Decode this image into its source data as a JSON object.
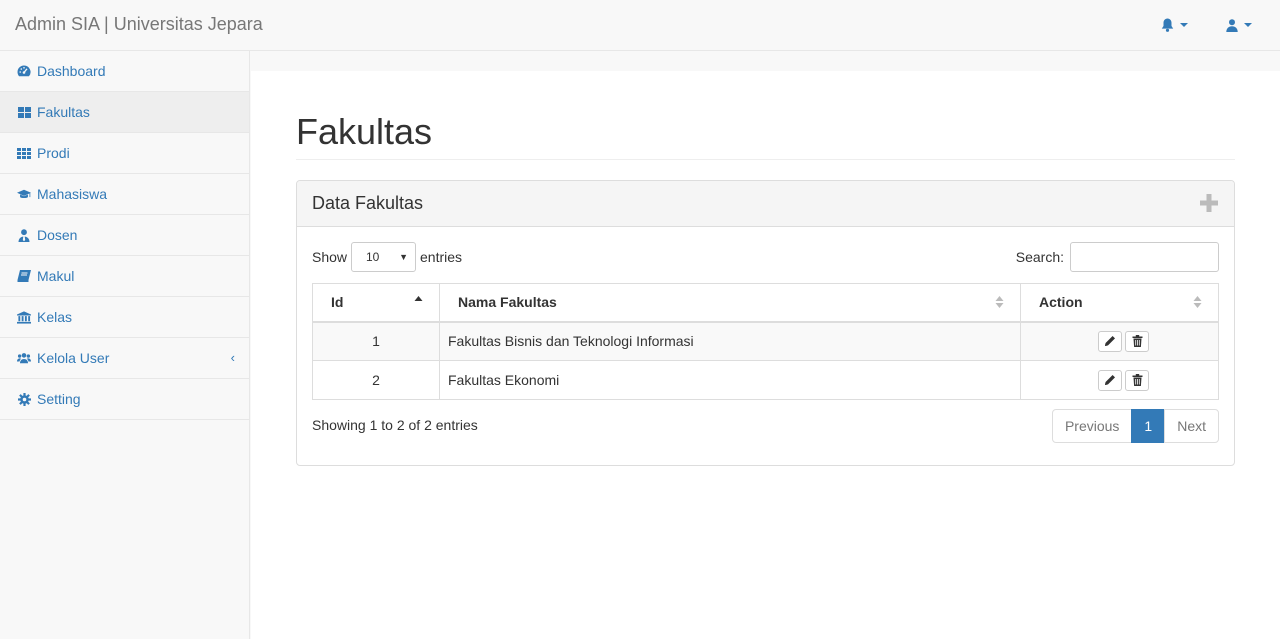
{
  "header": {
    "brand": "Admin SIA | Universitas Jepara"
  },
  "sidebar": {
    "items": [
      {
        "label": "Dashboard",
        "icon": "dashboard-icon"
      },
      {
        "label": "Fakultas",
        "icon": "th-large-icon",
        "active": true
      },
      {
        "label": "Prodi",
        "icon": "th-icon"
      },
      {
        "label": "Mahasiswa",
        "icon": "graduation-cap-icon"
      },
      {
        "label": "Dosen",
        "icon": "user-tie-icon"
      },
      {
        "label": "Makul",
        "icon": "book-icon"
      },
      {
        "label": "Kelas",
        "icon": "university-icon"
      },
      {
        "label": "Kelola User",
        "icon": "users-icon",
        "expandable": true
      },
      {
        "label": "Setting",
        "icon": "gear-icon"
      }
    ]
  },
  "main": {
    "title": "Fakultas",
    "panel_title": "Data Fakultas",
    "show_label": "Show",
    "page_length": "10",
    "entries_label": "entries",
    "search_label": "Search:",
    "search_value": "",
    "columns": [
      "Id",
      "Nama Fakultas",
      "Action"
    ],
    "rows": [
      {
        "id": "1",
        "name": "Fakultas Bisnis dan Teknologi Informasi"
      },
      {
        "id": "2",
        "name": "Fakultas Ekonomi"
      }
    ],
    "info": "Showing 1 to 2 of 2 entries",
    "pagination": {
      "previous": "Previous",
      "current": "1",
      "next": "Next"
    }
  },
  "colors": {
    "accent": "#337ab7",
    "text": "#333333",
    "muted": "#777777",
    "border": "#dddddd"
  }
}
